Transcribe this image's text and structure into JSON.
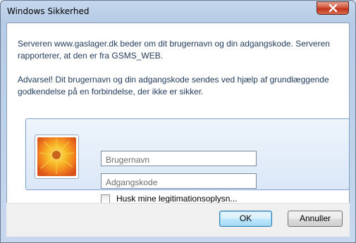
{
  "window": {
    "title": "Windows Sikkerhed"
  },
  "message": {
    "line1": "Serveren www.gaslager.dk beder om dit brugernavn og din adgangskode. Serveren rapporterer, at den er fra GSMS_WEB.",
    "warning": "Advarsel! Dit brugernavn og din adgangskode sendes ved hjælp af grundlæggende godkendelse på en forbindelse, der ikke er sikker."
  },
  "credentials": {
    "username_placeholder": "Brugernavn",
    "password_placeholder": "Adgangskode",
    "remember_label": "Husk mine legitimationsoplysn..."
  },
  "buttons": {
    "ok": "OK",
    "cancel": "Annuller"
  },
  "icons": {
    "close": "close-icon",
    "user_tile": "flower-user-tile-icon"
  },
  "colors": {
    "message_text": "#1e395b",
    "close_button": "#c1341a"
  }
}
